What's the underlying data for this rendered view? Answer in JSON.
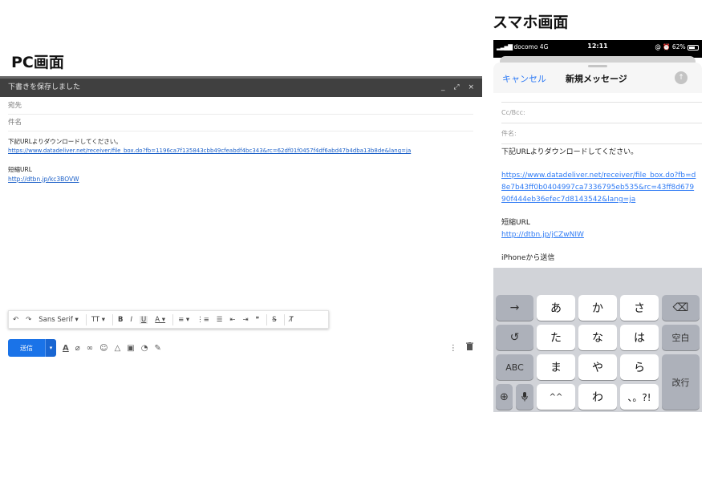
{
  "headings": {
    "pc": "PC画面",
    "phone": "スマホ画面"
  },
  "pc": {
    "title": "下書きを保存しました",
    "window_controls": "_ ⤢ ×",
    "to_label": "宛先",
    "subject_label": "件名",
    "body_line1": "下記URLよりダウンロードしてください。",
    "body_link": "https://www.datadeliver.net/receiver/file_box.do?fb=1196ca7f135843cbb49cfeabdf4bc343&rc=62df01f0457f4df6abd47b4dba13b8de&lang=ja",
    "short_label": "短縮URL",
    "short_link": "http://dtbn.jp/kc3BOVW",
    "toolbar": {
      "undo": "↶",
      "redo": "↷",
      "font": "Sans Serif ▾",
      "size": "TT ▾",
      "bold": "B",
      "italic": "I",
      "underline": "U",
      "text_color": "A ▾",
      "align": "≡ ▾",
      "numbered": "⋮≡",
      "bulleted": "☰",
      "indent_less": "⇤",
      "indent_more": "⇥",
      "quote": "❞",
      "strike": "S̶",
      "clear": "T̸"
    },
    "send_label": "送信",
    "send_icons": {
      "format": "A",
      "attach": "⌀",
      "link": "∞",
      "emoji": "☺",
      "drive": "△",
      "photo": "▣",
      "lock": "◔",
      "sign": "✎"
    },
    "more_icon": "⋮",
    "trash_icon": "🗑"
  },
  "phone": {
    "carrier": "docomo 4G",
    "time": "12:11",
    "battery": "@ ⏰ 62%",
    "cancel": "キャンセル",
    "title": "新規メッセージ",
    "cc_label": "Cc/Bcc:",
    "subject_label": "件名:",
    "body_line1": "下記URLよりダウンロードしてください。",
    "body_link": "https://www.datadeliver.net/receiver/file_box.do?fb=d8e7b43ff0b0404997ca7336795eb535&rc=43ff8d67990f444eb36efec7d8143542&lang=ja",
    "short_label": "短縮URL",
    "short_link": "http://dtbn.jp/jCZwNIW",
    "signature": "iPhoneから送信",
    "keys": {
      "arrow": "→",
      "a": "あ",
      "ka": "か",
      "sa": "さ",
      "del": "⌫",
      "undo": "↺",
      "ta": "た",
      "na": "な",
      "ha": "は",
      "space": "空白",
      "abc": "ABC",
      "ma": "ま",
      "ya": "や",
      "ra": "ら",
      "enter": "改行",
      "globe": "⊕",
      "mic": "🎙",
      "kao": "^^",
      "wa": "わ",
      "punct": "、。?!"
    }
  }
}
